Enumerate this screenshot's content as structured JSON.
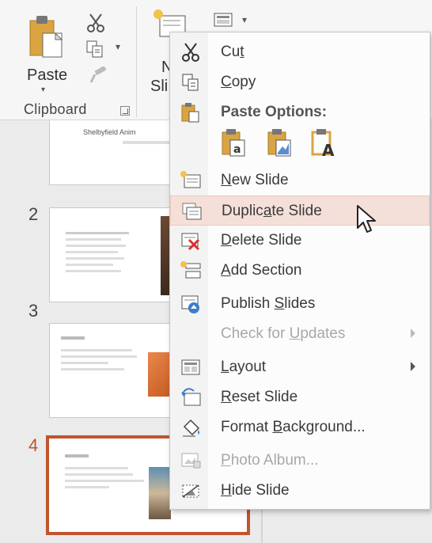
{
  "ribbon": {
    "paste_label": "Paste",
    "clipboard_group_label": "Clipboard",
    "new_slide_label_partial_1": "N",
    "new_slide_label_partial_2": "Sli"
  },
  "slides": [
    {
      "number": "",
      "title": "Shelbyfield Anim"
    },
    {
      "number": "2"
    },
    {
      "number": "3"
    },
    {
      "number": "4"
    }
  ],
  "context_menu": {
    "items": [
      {
        "label_pre": "Cu",
        "label_key": "t",
        "label_post": "",
        "icon": "scissors-icon",
        "enabled": true
      },
      {
        "label_pre": "",
        "label_key": "C",
        "label_post": "opy",
        "icon": "copy-icon",
        "enabled": true
      },
      {
        "label_pre": "Paste Options:",
        "label_key": "",
        "label_post": "",
        "icon": "paste-icon",
        "enabled": true
      },
      {
        "label_pre": "",
        "label_key": "N",
        "label_post": "ew Slide",
        "icon": "new-slide-icon",
        "enabled": true
      },
      {
        "label_pre": "Duplic",
        "label_key": "a",
        "label_post": "te Slide",
        "icon": "duplicate-slide-icon",
        "enabled": true,
        "highlighted": true
      },
      {
        "label_pre": "",
        "label_key": "D",
        "label_post": "elete Slide",
        "icon": "delete-slide-icon",
        "enabled": true
      },
      {
        "label_pre": "",
        "label_key": "A",
        "label_post": "dd Section",
        "icon": "add-section-icon",
        "enabled": true
      },
      {
        "label_pre": "Publish ",
        "label_key": "S",
        "label_post": "lides",
        "icon": "publish-slides-icon",
        "enabled": true
      },
      {
        "label_pre": "Check for ",
        "label_key": "U",
        "label_post": "pdates",
        "icon": "",
        "enabled": false,
        "submenu": true
      },
      {
        "label_pre": "",
        "label_key": "L",
        "label_post": "ayout",
        "icon": "layout-icon",
        "enabled": true,
        "submenu": true
      },
      {
        "label_pre": "",
        "label_key": "R",
        "label_post": "eset Slide",
        "icon": "reset-slide-icon",
        "enabled": true
      },
      {
        "label_pre": "Format ",
        "label_key": "B",
        "label_post": "ackground...",
        "icon": "format-background-icon",
        "enabled": true
      },
      {
        "label_pre": "",
        "label_key": "P",
        "label_post": "hoto Album...",
        "icon": "photo-album-icon",
        "enabled": false
      },
      {
        "label_pre": "",
        "label_key": "H",
        "label_post": "ide Slide",
        "icon": "hide-slide-icon",
        "enabled": true
      }
    ],
    "paste_option_letters": [
      "a",
      "A"
    ]
  },
  "colors": {
    "accent": "#c0542e",
    "hover_bg": "#f4e0d9",
    "paste_gold": "#d9a441"
  }
}
